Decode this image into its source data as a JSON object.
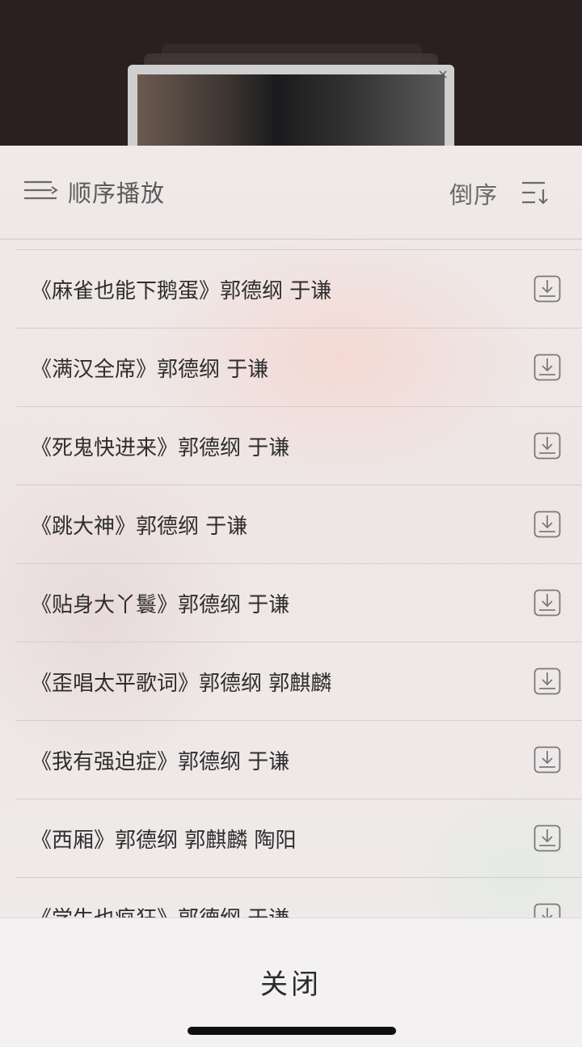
{
  "header": {
    "play_mode_label": "顺序播放",
    "play_mode_icon": "sequential-play-icon",
    "reverse_label": "倒序",
    "sort_icon": "sort-icon"
  },
  "playlist": {
    "items": [
      {
        "title": "《麻雀也能下鹅蛋》郭德纲 于谦"
      },
      {
        "title": "《满汉全席》郭德纲 于谦"
      },
      {
        "title": "《死鬼快进来》郭德纲 于谦"
      },
      {
        "title": "《跳大神》郭德纲 于谦"
      },
      {
        "title": "《贴身大丫鬟》郭德纲 于谦"
      },
      {
        "title": "《歪唱太平歌词》郭德纲 郭麒麟"
      },
      {
        "title": "《我有强迫症》郭德纲 于谦"
      },
      {
        "title": "《西厢》郭德纲 郭麒麟 陶阳"
      },
      {
        "title": "《学生也疯狂》郭德纲 于谦"
      }
    ],
    "download_icon": "download-icon"
  },
  "footer": {
    "close_label": "关闭"
  },
  "video": {
    "close_glyph": "×"
  }
}
